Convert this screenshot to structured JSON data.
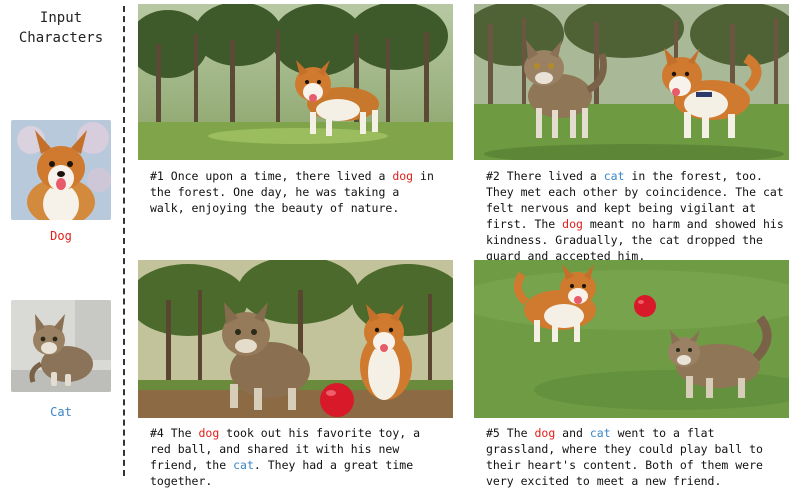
{
  "sidebar": {
    "title_line1": "Input",
    "title_line2": "Characters",
    "characters": [
      {
        "label": "Dog",
        "color": "#e0201b"
      },
      {
        "label": "Cat",
        "color": "#3a86c8"
      }
    ]
  },
  "panels": [
    {
      "segments": [
        {
          "t": "#1 Once upon a time, there lived a "
        },
        {
          "t": "dog",
          "k": "dog"
        },
        {
          "t": " in the forest. One day, he was taking a walk, enjoying the beauty of nature."
        }
      ]
    },
    {
      "segments": [
        {
          "t": "#2 There lived a "
        },
        {
          "t": "cat",
          "k": "cat"
        },
        {
          "t": " in the forest, too. They met each other by coincidence. The cat felt nervous and kept being vigilant at first. The "
        },
        {
          "t": "dog",
          "k": "dog"
        },
        {
          "t": " meant no harm and showed his kindness. Gradually, the cat dropped the guard and accepted him."
        }
      ]
    },
    {
      "segments": [
        {
          "t": "#4 The "
        },
        {
          "t": "dog",
          "k": "dog"
        },
        {
          "t": " took out his favorite toy, a red ball, and shared it with his new friend, the "
        },
        {
          "t": "cat",
          "k": "cat"
        },
        {
          "t": ". They had a great time together."
        }
      ]
    },
    {
      "segments": [
        {
          "t": "#5 The "
        },
        {
          "t": "dog",
          "k": "dog"
        },
        {
          "t": " and "
        },
        {
          "t": "cat",
          "k": "cat"
        },
        {
          "t": " went to a flat grassland, where they could play ball to their heart's content. Both of them were very excited to meet a new friend."
        }
      ]
    }
  ]
}
